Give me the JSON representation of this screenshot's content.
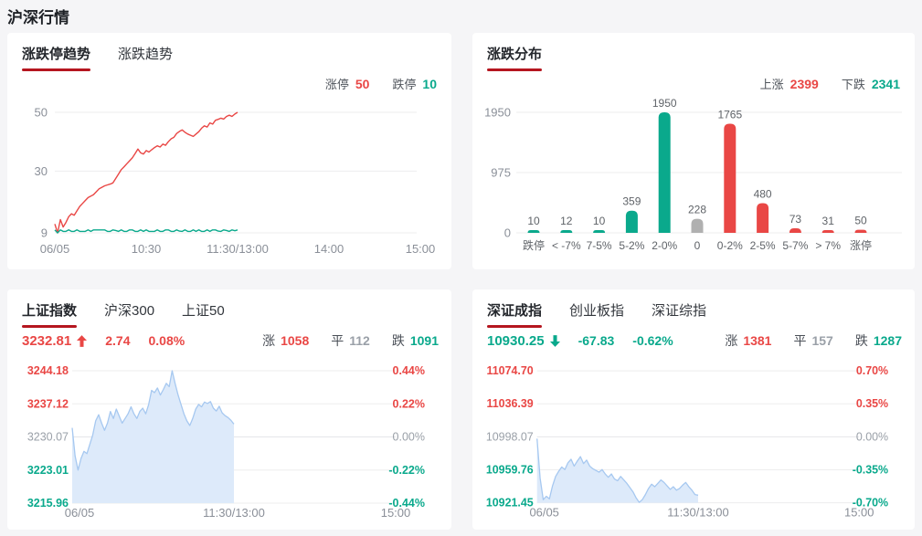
{
  "page": {
    "title": "沪深行情"
  },
  "colors": {
    "up": "#e94745",
    "down": "#0aa98c",
    "flat": "#9aa0a8",
    "flat_bar": "#b0b0b0",
    "underline": "#b5161f",
    "blue_line": "#a6c8f0",
    "blue_fill": "#ddeafa",
    "grid": "#ededee",
    "axis_text": "#8a8f98",
    "bar_label": "#5f6368"
  },
  "panels": {
    "limit_trend": {
      "tabs": [
        {
          "label": "涨跌停趋势"
        },
        {
          "label": "涨跌趋势"
        }
      ],
      "legend": [
        {
          "label": "涨停",
          "value": "50",
          "type": "up"
        },
        {
          "label": "跌停",
          "value": "10",
          "type": "down"
        }
      ]
    },
    "distribution": {
      "tabs": [
        {
          "label": "涨跌分布"
        }
      ],
      "legend": [
        {
          "label": "上涨",
          "value": "2399",
          "type": "up"
        },
        {
          "label": "下跌",
          "value": "2341",
          "type": "down"
        }
      ]
    },
    "sse": {
      "tabs": [
        {
          "label": "上证指数"
        },
        {
          "label": "沪深300"
        },
        {
          "label": "上证50"
        }
      ],
      "stats": {
        "price": "3232.81",
        "direction": "up",
        "change": "2.74",
        "change_pct": "0.08%",
        "counts": [
          {
            "label": "涨",
            "value": "1058",
            "type": "up"
          },
          {
            "label": "平",
            "value": "112",
            "type": "flat"
          },
          {
            "label": "跌",
            "value": "1091",
            "type": "down"
          }
        ]
      }
    },
    "szse": {
      "tabs": [
        {
          "label": "深证成指"
        },
        {
          "label": "创业板指"
        },
        {
          "label": "深证综指"
        }
      ],
      "stats": {
        "price": "10930.25",
        "direction": "down",
        "change": "-67.83",
        "change_pct": "-0.62%",
        "counts": [
          {
            "label": "涨",
            "value": "1381",
            "type": "up"
          },
          {
            "label": "平",
            "value": "157",
            "type": "flat"
          },
          {
            "label": "跌",
            "value": "1287",
            "type": "down"
          }
        ]
      }
    }
  },
  "chart_data": [
    {
      "id": "limit_trend",
      "type": "line",
      "title": "涨跌停趋势",
      "x_ticks": [
        "06/05",
        "10:30",
        "11:30/13:00",
        "14:00",
        "15:00"
      ],
      "y_ticks": [
        50,
        30,
        9
      ],
      "ylim": [
        9,
        50
      ],
      "grid": true,
      "data_end_fraction": 0.5,
      "series": [
        {
          "name": "涨停",
          "color_key": "up",
          "values": [
            12,
            9,
            13.5,
            11,
            12.5,
            14.5,
            15.5,
            15,
            16.5,
            18,
            19,
            20,
            21,
            21.5,
            22,
            23,
            24,
            24.5,
            25,
            25.3,
            25.6,
            26,
            27.5,
            29,
            30.5,
            31.5,
            32.5,
            33.5,
            34.5,
            36,
            37.5,
            36.2,
            35.8,
            37,
            36.5,
            37.3,
            38,
            38.6,
            38.2,
            39.2,
            38.8,
            40,
            41,
            41.5,
            42.8,
            43.5,
            44,
            43.2,
            42.6,
            42.2,
            41.8,
            42.6,
            43.4,
            44.6,
            45.4,
            45,
            46.4,
            46,
            47.3,
            47.6,
            48,
            47.7,
            48.6,
            49,
            48.6,
            49.4,
            50
          ]
        },
        {
          "name": "跌停",
          "color_key": "down",
          "values": [
            10,
            9,
            10,
            9.5,
            9.5,
            10,
            9.5,
            9.5,
            10,
            9.5,
            9.5,
            9.5,
            10,
            9.5,
            10,
            10,
            10,
            10,
            10,
            9.5,
            9.5,
            10,
            9.8,
            9.5,
            10,
            9.5,
            9.5,
            10,
            10,
            9.5,
            9.5,
            10,
            9.5,
            10,
            9.5,
            9.5,
            9.5,
            10,
            9.5,
            9.5,
            10,
            10,
            9.5,
            9.5,
            10,
            9.6,
            9.5,
            10,
            9.5,
            9.5,
            10,
            9.5,
            10,
            9.5,
            9.5,
            10,
            9.5,
            10,
            10,
            9.6,
            9.5,
            10,
            9.8,
            9.5,
            10,
            9.7,
            10
          ]
        }
      ]
    },
    {
      "id": "distribution",
      "type": "bar",
      "title": "涨跌分布",
      "categories": [
        "跌停",
        "< -7%",
        "7-5%",
        "5-2%",
        "2-0%",
        "0",
        "0-2%",
        "2-5%",
        "5-7%",
        "> 7%",
        "涨停"
      ],
      "values": [
        10,
        12,
        10,
        359,
        1950,
        228,
        1765,
        480,
        73,
        31,
        50
      ],
      "bar_color_keys": [
        "down",
        "down",
        "down",
        "down",
        "down",
        "flat",
        "up",
        "up",
        "up",
        "up",
        "up"
      ],
      "y_ticks": [
        1950,
        975,
        0
      ],
      "ylim": [
        0,
        1950
      ],
      "grid": true
    },
    {
      "id": "sse",
      "type": "area",
      "title": "上证指数",
      "left_ticks": [
        "3244.18",
        "3237.12",
        "3230.07",
        "3223.01",
        "3215.96"
      ],
      "right_ticks": [
        "0.44%",
        "0.22%",
        "0.00%",
        "-0.22%",
        "-0.44%"
      ],
      "tick_color_keys": [
        "up",
        "up",
        "flat",
        "down",
        "down"
      ],
      "x_ticks": [
        "06/05",
        "11:30/13:00",
        "15:00"
      ],
      "ylim": [
        3215.96,
        3244.18
      ],
      "prev_close": 3230.07,
      "grid": true,
      "data_end_fraction": 0.5,
      "values": [
        3232,
        3226,
        3223,
        3225.5,
        3227,
        3226.5,
        3228.5,
        3230.5,
        3233.5,
        3234.8,
        3233,
        3231.5,
        3233,
        3235.5,
        3234,
        3236,
        3234.5,
        3233,
        3234,
        3235,
        3236.5,
        3235,
        3234,
        3235.5,
        3236.2,
        3235,
        3237,
        3240,
        3239.5,
        3240.5,
        3239,
        3240.2,
        3241.5,
        3240.8,
        3244.18,
        3241.5,
        3239,
        3237,
        3235,
        3233.5,
        3232.5,
        3234,
        3236,
        3237,
        3236.5,
        3237.5,
        3237.2,
        3237.6,
        3236.2,
        3235.6,
        3236.6,
        3235.2,
        3234.6,
        3234.2,
        3233.6,
        3232.81
      ]
    },
    {
      "id": "szse",
      "type": "area",
      "title": "深证成指",
      "left_ticks": [
        "11074.70",
        "11036.39",
        "10998.07",
        "10959.76",
        "10921.45"
      ],
      "right_ticks": [
        "0.70%",
        "0.35%",
        "0.00%",
        "-0.35%",
        "-0.70%"
      ],
      "tick_color_keys": [
        "up",
        "up",
        "flat",
        "down",
        "down"
      ],
      "x_ticks": [
        "06/05",
        "11:30/13:00",
        "15:00"
      ],
      "ylim": [
        10921.45,
        11074.7
      ],
      "prev_close": 10998.07,
      "grid": true,
      "data_end_fraction": 0.5,
      "values": [
        10996,
        10950,
        10925,
        10929,
        10926,
        10941,
        10952,
        10958,
        10963,
        10960,
        10968,
        10972,
        10964,
        10970,
        10975,
        10967,
        10971,
        10964,
        10961,
        10959,
        10957,
        10960,
        10955,
        10951,
        10955,
        10949,
        10947,
        10952,
        10948,
        10944,
        10939,
        10934,
        10927,
        10922,
        10925,
        10931,
        10938,
        10943,
        10940,
        10944,
        10948,
        10945,
        10941,
        10937,
        10940,
        10936,
        10938,
        10942,
        10945,
        10940,
        10936,
        10931,
        10930.25
      ]
    }
  ]
}
